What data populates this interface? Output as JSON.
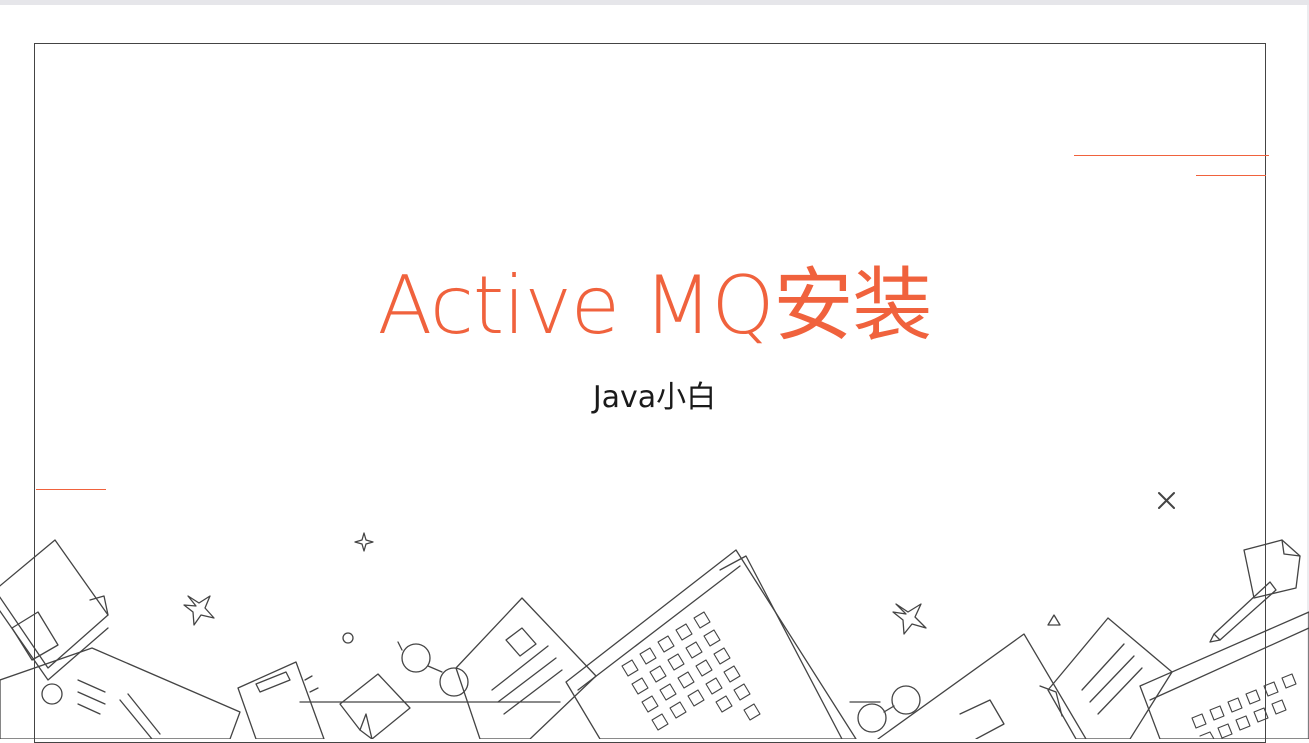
{
  "slide": {
    "title": "Active MQ安装",
    "subtitle": "Java小白"
  },
  "colors": {
    "accent": "#f0623d",
    "text": "#1a1a1a",
    "line": "#444444"
  },
  "icons": [
    "close-x-icon",
    "sparkle-icon",
    "star-icon",
    "circle-icon",
    "triangle-icon",
    "desk-doodle-illustration"
  ]
}
